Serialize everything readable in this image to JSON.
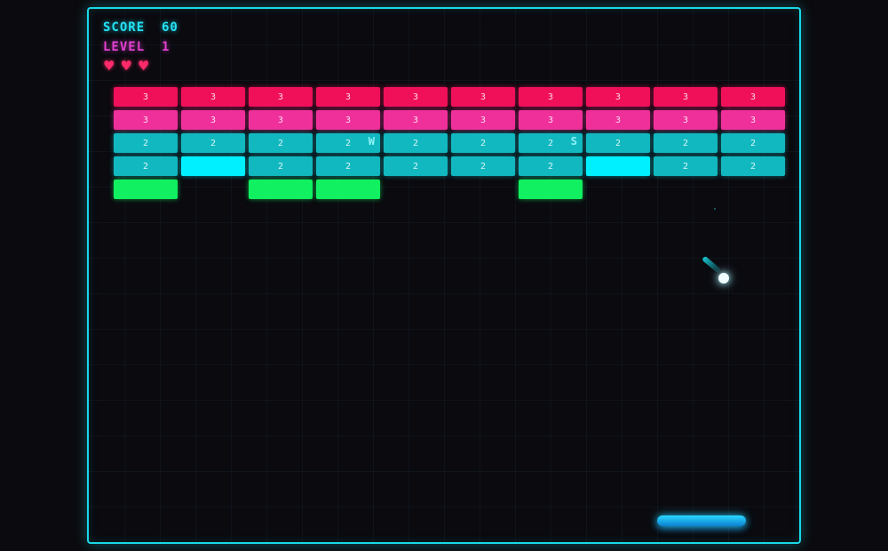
{
  "hud": {
    "score_text": "SCORE  60",
    "level_text": "LEVEL  1",
    "lives": 3,
    "life_glyph": "♥"
  },
  "colors": {
    "accent": "#19d9e6",
    "red": "#f0105a",
    "pink": "#f0309a",
    "teal": "#12b8c0",
    "cyan": "#00f0ff",
    "green": "#10f060"
  },
  "bricks": [
    [
      {
        "c": "red",
        "t": "3"
      },
      {
        "c": "red",
        "t": "3"
      },
      {
        "c": "red",
        "t": "3"
      },
      {
        "c": "red",
        "t": "3"
      },
      {
        "c": "red",
        "t": "3"
      },
      {
        "c": "red",
        "t": "3"
      },
      {
        "c": "red",
        "t": "3"
      },
      {
        "c": "red",
        "t": "3"
      },
      {
        "c": "red",
        "t": "3"
      },
      {
        "c": "red",
        "t": "3"
      }
    ],
    [
      {
        "c": "pink",
        "t": "3"
      },
      {
        "c": "pink",
        "t": "3"
      },
      {
        "c": "pink",
        "t": "3"
      },
      {
        "c": "pink",
        "t": "3"
      },
      {
        "c": "pink",
        "t": "3"
      },
      {
        "c": "pink",
        "t": "3"
      },
      {
        "c": "pink",
        "t": "3"
      },
      {
        "c": "pink",
        "t": "3"
      },
      {
        "c": "pink",
        "t": "3"
      },
      {
        "c": "pink",
        "t": "3"
      }
    ],
    [
      {
        "c": "teal",
        "t": "2"
      },
      {
        "c": "teal",
        "t": "2"
      },
      {
        "c": "teal",
        "t": "2"
      },
      {
        "c": "teal",
        "t": "2",
        "p": "W"
      },
      {
        "c": "teal",
        "t": "2"
      },
      {
        "c": "teal",
        "t": "2"
      },
      {
        "c": "teal",
        "t": "2",
        "p": "S"
      },
      {
        "c": "teal",
        "t": "2"
      },
      {
        "c": "teal",
        "t": "2"
      },
      {
        "c": "teal",
        "t": "2"
      }
    ],
    [
      {
        "c": "teal",
        "t": "2"
      },
      {
        "c": "cyan",
        "t": ""
      },
      {
        "c": "teal",
        "t": "2"
      },
      {
        "c": "teal",
        "t": "2"
      },
      {
        "c": "teal",
        "t": "2"
      },
      {
        "c": "teal",
        "t": "2"
      },
      {
        "c": "teal",
        "t": "2"
      },
      {
        "c": "cyan",
        "t": ""
      },
      {
        "c": "teal",
        "t": "2"
      },
      {
        "c": "teal",
        "t": "2"
      }
    ],
    [
      {
        "c": "green",
        "t": ""
      },
      {
        "c": "empty"
      },
      {
        "c": "green",
        "t": ""
      },
      {
        "c": "green",
        "t": ""
      },
      {
        "c": "empty"
      },
      {
        "c": "empty"
      },
      {
        "c": "green",
        "t": ""
      },
      {
        "c": "empty"
      },
      {
        "c": "empty"
      },
      {
        "c": "empty"
      }
    ]
  ]
}
